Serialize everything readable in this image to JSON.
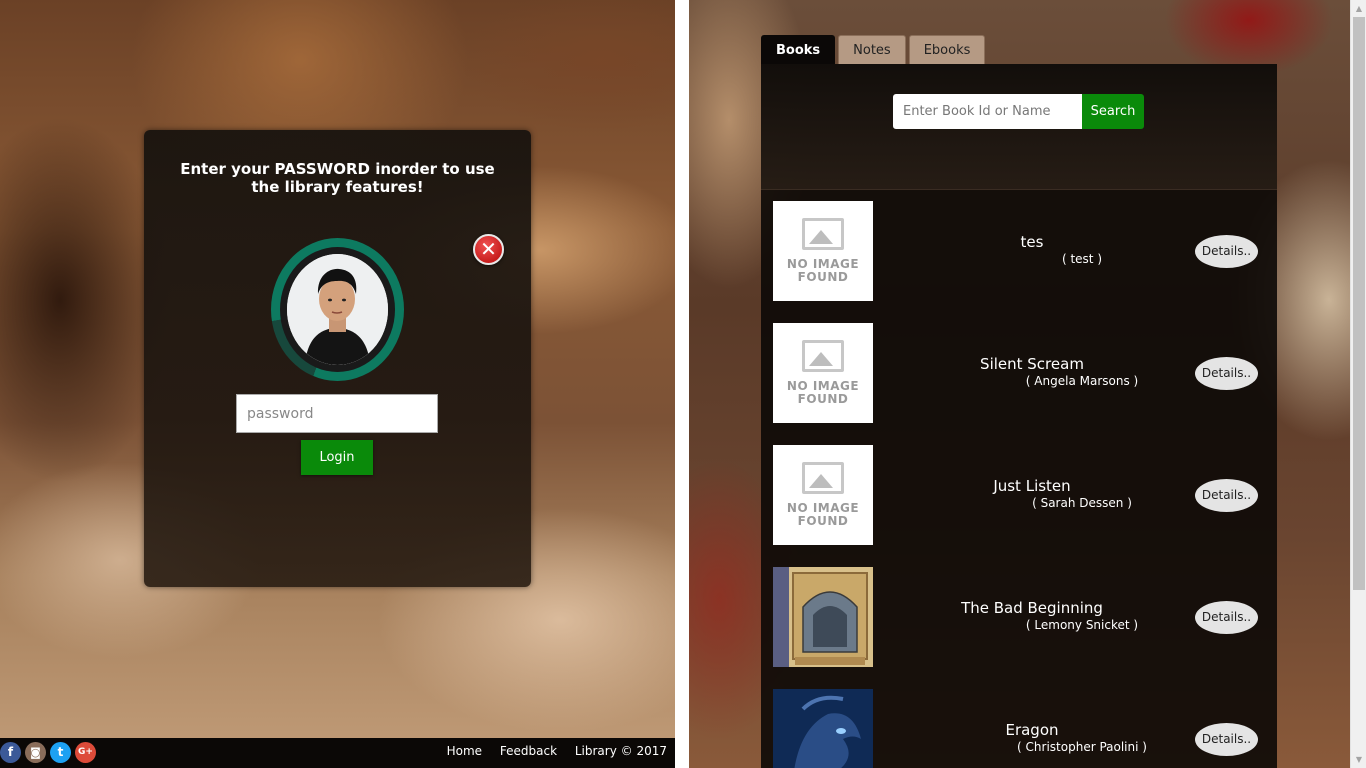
{
  "login": {
    "heading": "Enter your PASSWORD inorder to use the library features!",
    "close_icon": "close-icon",
    "password_placeholder": "password",
    "login_label": "Login"
  },
  "footer": {
    "social": [
      {
        "name": "facebook-icon",
        "glyph": "f",
        "color": "#3b5998"
      },
      {
        "name": "instagram-icon",
        "glyph": "◙",
        "color": "#8a6d5a"
      },
      {
        "name": "twitter-icon",
        "glyph": "t",
        "color": "#1da1f2"
      },
      {
        "name": "google-plus-icon",
        "glyph": "G+",
        "color": "#dd4b39"
      }
    ],
    "home": "Home",
    "feedback": "Feedback",
    "copyright": "Library © 2017"
  },
  "tabs": [
    {
      "label": "Books",
      "active": true
    },
    {
      "label": "Notes",
      "active": false
    },
    {
      "label": "Ebooks",
      "active": false
    }
  ],
  "search": {
    "placeholder": "Enter Book Id or Name",
    "button_label": "Search"
  },
  "no_image_text": "NO IMAGE FOUND",
  "books": [
    {
      "title": "tes",
      "author": "( test )",
      "details": "Details..",
      "has_image": false
    },
    {
      "title": "Silent Scream",
      "author": "( Angela Marsons )",
      "details": "Details..",
      "has_image": false
    },
    {
      "title": "Just Listen",
      "author": "( Sarah Dessen )",
      "details": "Details..",
      "has_image": false
    },
    {
      "title": "The Bad Beginning",
      "author": "( Lemony Snicket )",
      "details": "Details..",
      "has_image": true
    },
    {
      "title": "Eragon",
      "author": "( Christopher Paolini )",
      "details": "Details..",
      "has_image": true
    }
  ],
  "colors": {
    "accent_green": "#0a8a0a",
    "close_red": "#d32a2a",
    "avatar_ring": "#0d7a60"
  }
}
